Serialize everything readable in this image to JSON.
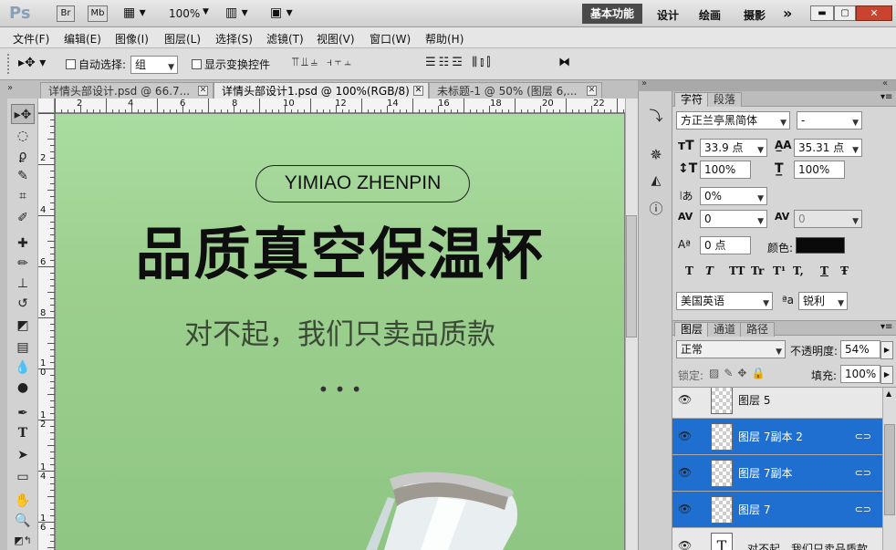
{
  "app": {
    "logo": "Ps",
    "br": "Br",
    "mb": "Mb",
    "zoom": "100%",
    "workspace_active": "基本功能",
    "workspaces": [
      "设计",
      "绘画",
      "摄影"
    ],
    "more": "»"
  },
  "menu": [
    "文件(F)",
    "编辑(E)",
    "图像(I)",
    "图层(L)",
    "选择(S)",
    "滤镜(T)",
    "视图(V)",
    "窗口(W)",
    "帮助(H)"
  ],
  "options": {
    "auto_select_label": "自动选择:",
    "auto_select_value": "组",
    "show_transform_label": "显示变换控件"
  },
  "tabs": [
    {
      "label": "详情头部设计.psd @ 66.7...",
      "close": "✕"
    },
    {
      "label": "详情头部设计1.psd @ 100%(RGB/8) *",
      "close": "✕"
    },
    {
      "label": "未标题-1 @ 50% (图层 6,...",
      "close": "✕"
    }
  ],
  "ruler": {
    "top": [
      "2",
      "4",
      "6",
      "8",
      "10",
      "12",
      "14",
      "16",
      "18",
      "20",
      "22"
    ],
    "left": [
      "2",
      "4",
      "6",
      "8",
      "10",
      "12",
      "14",
      "16",
      "18"
    ]
  },
  "document": {
    "badge": "YIMIAO ZHENPIN",
    "headline": "品质真空保温杯",
    "subline": "对不起，我们只卖品质款",
    "dots": "• • •"
  },
  "character_panel": {
    "tabs": [
      "字符",
      "段落"
    ],
    "font_family": "方正兰亭黑简体",
    "font_style": "-",
    "font_size": "33.9 点",
    "leading": "35.31 点",
    "vertical_scale": "100%",
    "horizontal_scale": "100%",
    "tracking_ratio": "0%",
    "kerning": "0",
    "tracking": "0",
    "baseline_shift": "0 点",
    "color_label": "颜色:",
    "color": "#0a0a0a",
    "style_buttons": [
      "T",
      "T",
      "TT",
      "Tr",
      "T¹",
      "T,",
      "T",
      "Ŧ"
    ],
    "language": "美国英语",
    "aa_label": "ªa",
    "antialias": "锐利"
  },
  "layers_panel": {
    "tabs": [
      "图层",
      "通道",
      "路径"
    ],
    "blend_mode": "正常",
    "opacity_label": "不透明度:",
    "opacity": "54%",
    "lock_label": "锁定:",
    "fill_label": "填充:",
    "fill": "100%",
    "layers": [
      {
        "name": "图层 5",
        "selected": false
      },
      {
        "name": "图层 7副本 2",
        "selected": true
      },
      {
        "name": "图层 7副本",
        "selected": true
      },
      {
        "name": "图层 7",
        "selected": true
      },
      {
        "name": "对不起，我们只卖品质款",
        "selected": false
      }
    ]
  }
}
